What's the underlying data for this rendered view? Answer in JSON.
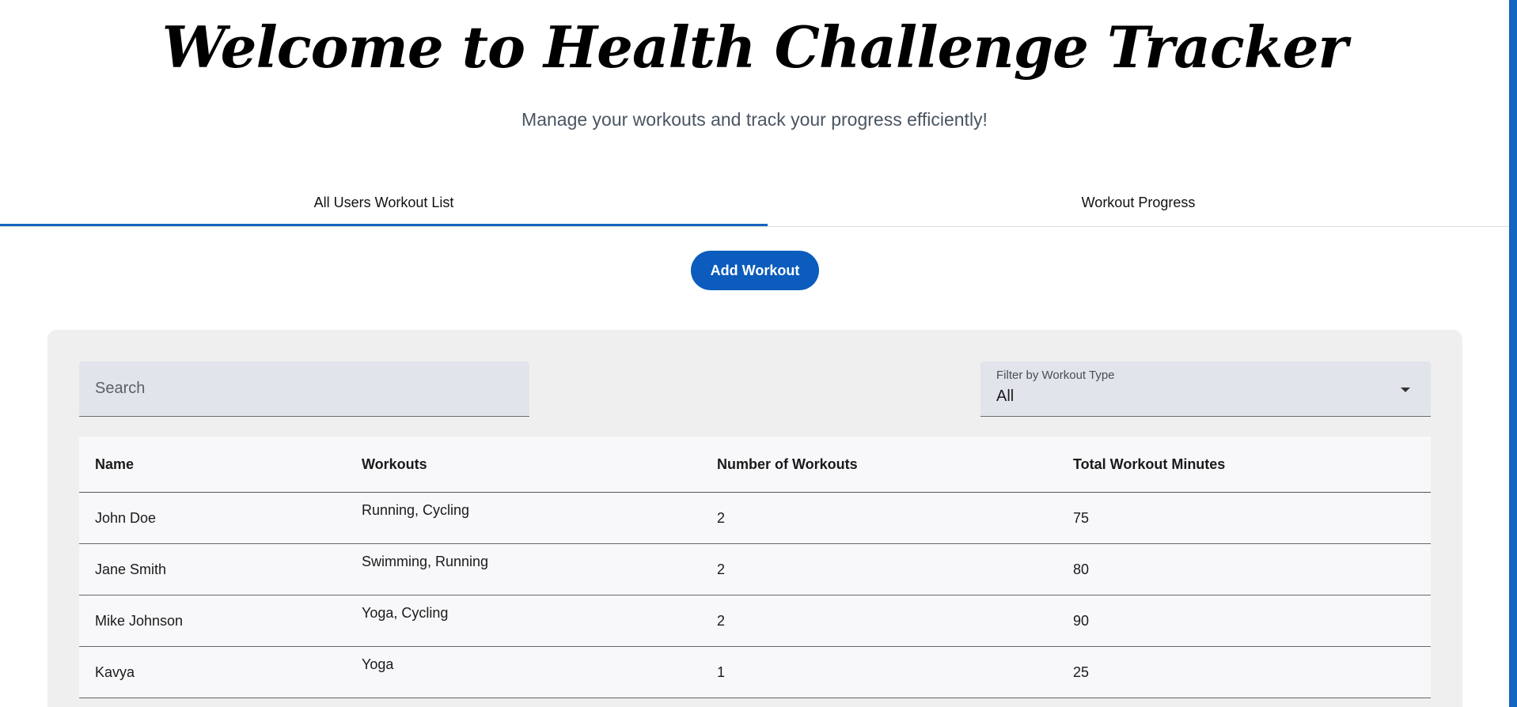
{
  "header": {
    "title": "Welcome to Health Challenge Tracker",
    "subtitle": "Manage your workouts and track your progress efficiently!"
  },
  "tabs": [
    {
      "label": "All Users Workout List",
      "active": true
    },
    {
      "label": "Workout Progress",
      "active": false
    }
  ],
  "actions": {
    "add_workout_label": "Add Workout"
  },
  "filters": {
    "search_placeholder": "Search",
    "workout_type_label": "Filter by Workout Type",
    "workout_type_value": "All"
  },
  "table": {
    "columns": [
      "Name",
      "Workouts",
      "Number of Workouts",
      "Total Workout Minutes"
    ],
    "rows": [
      {
        "name": "John Doe",
        "workouts": "Running, Cycling",
        "count": "2",
        "minutes": "75"
      },
      {
        "name": "Jane Smith",
        "workouts": "Swimming, Running",
        "count": "2",
        "minutes": "80"
      },
      {
        "name": "Mike Johnson",
        "workouts": "Yoga, Cycling",
        "count": "2",
        "minutes": "90"
      },
      {
        "name": "Kavya",
        "workouts": "Yoga",
        "count": "1",
        "minutes": "25"
      }
    ]
  },
  "colors": {
    "accent": "#1565c0",
    "button": "#0b5cbd",
    "panel": "#efefef",
    "field": "#e2e4ec"
  }
}
